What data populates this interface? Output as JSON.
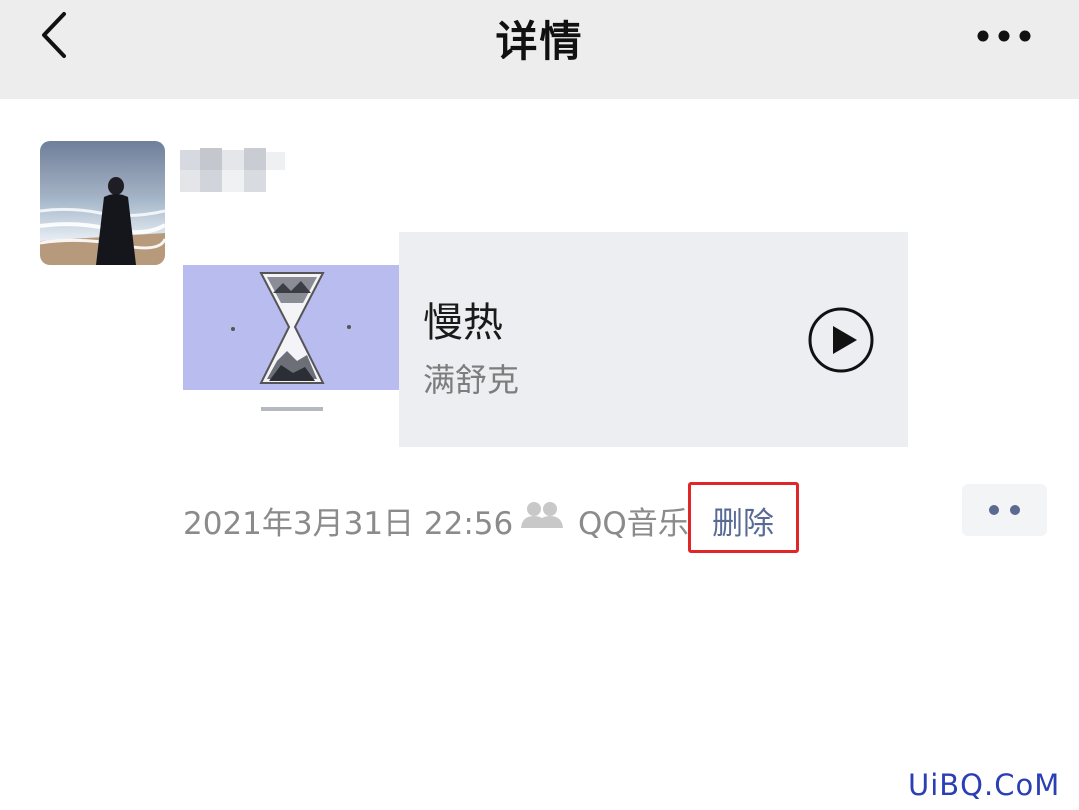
{
  "navbar": {
    "title": "详情",
    "back_icon": "chevron-left-icon",
    "more_icon": "more-dots-icon"
  },
  "post": {
    "avatar_alt": "avatar",
    "music": {
      "title": "慢热",
      "artist": "满舒克",
      "play_icon": "play-icon"
    },
    "timestamp": "2021年3月31日 22:56",
    "privacy_icon": "friends-icon",
    "source": "QQ音乐",
    "delete_label": "删除",
    "action_icon": "two-dots-icon"
  },
  "watermark": "UiBQ.CoM",
  "colors": {
    "navbar_bg": "#ededed",
    "link_blue": "#576b95",
    "highlight_red": "#e02626",
    "meta_gray": "#8b8b8b"
  }
}
